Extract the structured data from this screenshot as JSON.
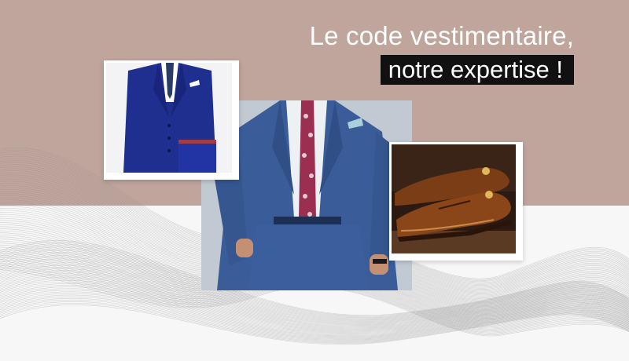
{
  "headline": {
    "line1": "Le code vestimentaire,",
    "line2": "notre expertise !"
  },
  "colors": {
    "top_background": "#bfa59c",
    "bottom_background": "#f7f7f7",
    "highlight_box": "#111111",
    "headline_text": "#ffffff"
  },
  "images": [
    {
      "name": "three-piece-suit",
      "description_icon": "suit-jacket-icon"
    },
    {
      "name": "man-in-blue-suit",
      "description_icon": "man-suit-icon"
    },
    {
      "name": "brown-oxford-shoes",
      "description_icon": "shoes-icon"
    }
  ]
}
